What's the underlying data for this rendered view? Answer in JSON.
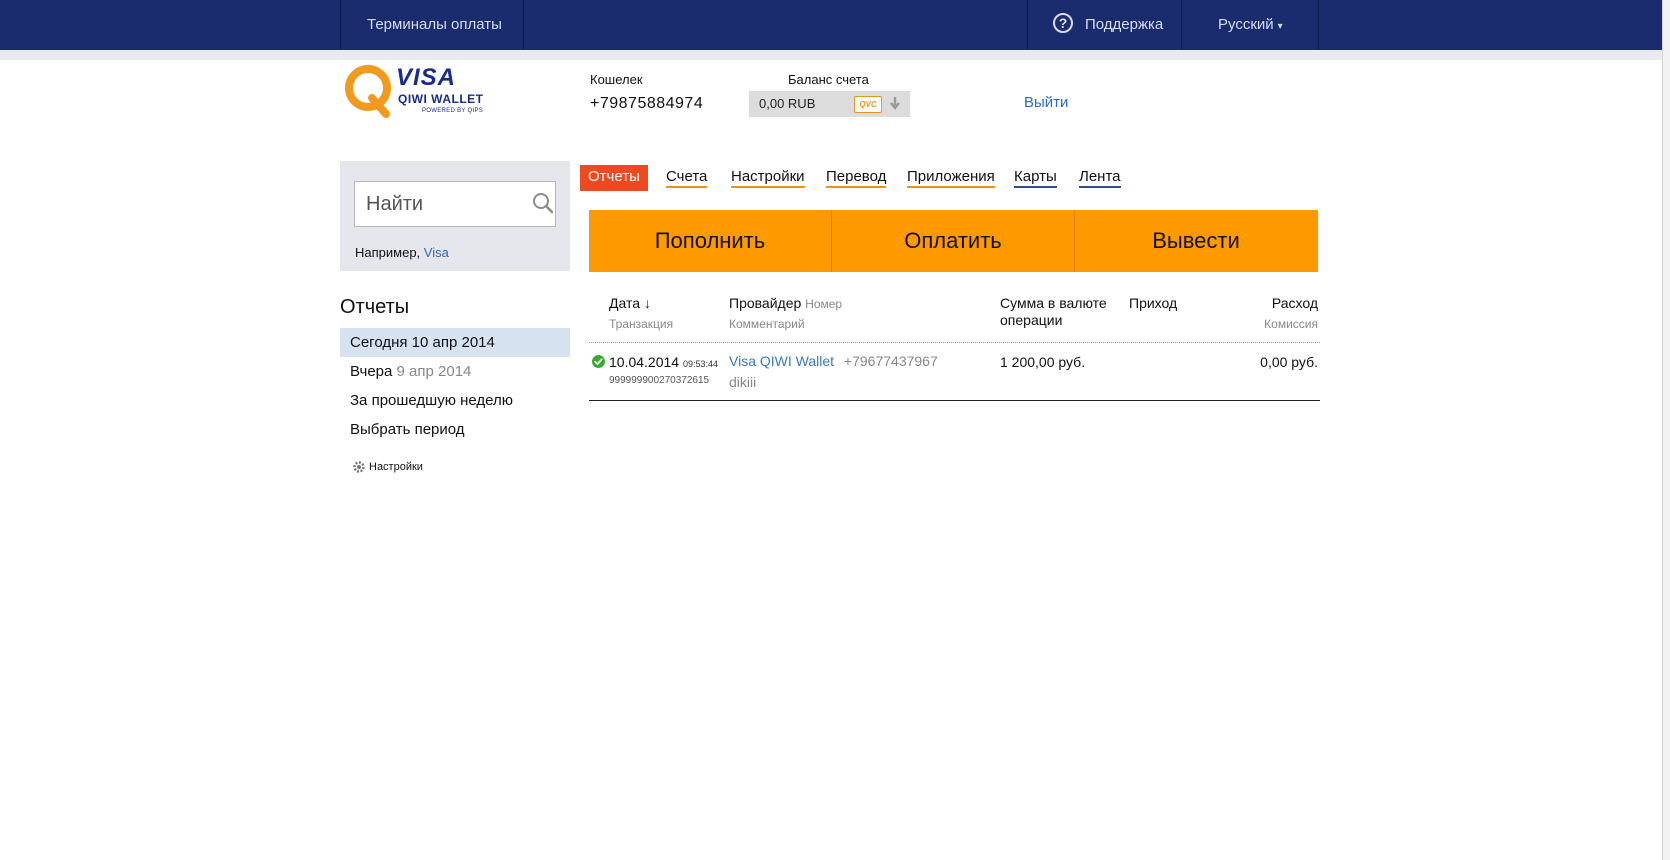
{
  "topbar": {
    "terminals": "Терминалы оплаты",
    "support": "Поддержка",
    "help_glyph": "?",
    "language": "Русский",
    "caret": "▾"
  },
  "brand": {
    "visa": "VISA",
    "wallet": "QIWI WALLET",
    "powered": "POWERED BY QIPS",
    "colors": {
      "navy": "#1a2b6e",
      "orange": "#ff9900",
      "red_tab": "#ee4a22",
      "link": "#2c6bb5"
    }
  },
  "account": {
    "wallet_label": "Кошелек",
    "wallet_phone": "+79875884974",
    "balance_label": "Баланс счета",
    "balance_value": "0,00 RUB",
    "qvc_badge": "QVC",
    "logout": "Выйти"
  },
  "search": {
    "placeholder": "Найти",
    "hint_prefix": "Например, ",
    "hint_link": "Visa"
  },
  "sidebar": {
    "title": "Отчеты",
    "items": [
      {
        "label": "Сегодня 10 апр 2014",
        "muted": ""
      },
      {
        "label": "Вчера ",
        "muted": "9 апр 2014"
      },
      {
        "label": "За прошедшую неделю",
        "muted": ""
      },
      {
        "label": "Выбрать период",
        "muted": ""
      }
    ],
    "settings": "Настройки"
  },
  "tabs": [
    {
      "label": "Отчеты"
    },
    {
      "label": "Счета"
    },
    {
      "label": "Настройки"
    },
    {
      "label": "Перевод"
    },
    {
      "label": "Приложения"
    },
    {
      "label": "Карты"
    },
    {
      "label": "Лента"
    }
  ],
  "actions": {
    "topup": "Пополнить",
    "pay": "Оплатить",
    "withdraw": "Вывести"
  },
  "table": {
    "headers": {
      "date": "Дата ↓",
      "transaction": "Транзакция",
      "provider": "Провайдер",
      "number": "Номер",
      "comment": "Комментарий",
      "amount_line1": "Сумма в валюте",
      "amount_line2": "операции",
      "income": "Приход",
      "expense": "Расход",
      "commission": "Комиссия"
    },
    "rows": [
      {
        "date": "10.04.2014",
        "time": "09:53:44",
        "transaction": "999999900270372615",
        "provider": "Visa QIWI Wallet",
        "number": "+79677437967",
        "comment": "dikiii",
        "amount": "1 200,00 руб.",
        "income": "",
        "expense": "0,00 руб.",
        "status": "success"
      }
    ]
  }
}
